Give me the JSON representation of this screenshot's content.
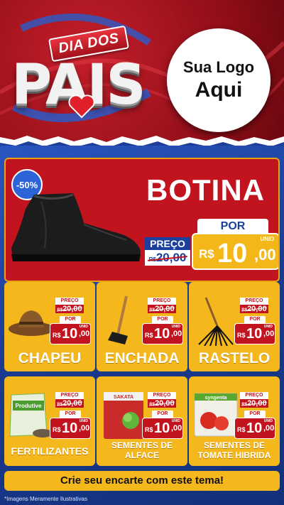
{
  "header": {
    "dia_dos": "DIA DOS",
    "pais": "PAIS",
    "logo_line1": "Sua Logo",
    "logo_line2": "Aqui"
  },
  "featured": {
    "discount": "-50%",
    "name": "BOTINA",
    "preco_label": "PREÇO",
    "old_currency": "R$",
    "old_price": "20,00",
    "por_label": "POR",
    "currency": "R$",
    "price_int": "10",
    "price_cents": ",00",
    "unit": "UNID"
  },
  "products": [
    {
      "name": "CHAPEU",
      "preco_label": "PREÇO",
      "old_currency": "R$",
      "old_price": "20,00",
      "por_label": "POR",
      "currency": "R$",
      "price_int": "10",
      "price_cents": ",00",
      "unit": "UNID"
    },
    {
      "name": "ENCHADA",
      "preco_label": "PREÇO",
      "old_currency": "R$",
      "old_price": "20,00",
      "por_label": "POR",
      "currency": "R$",
      "price_int": "10",
      "price_cents": ",00",
      "unit": "UNID"
    },
    {
      "name": "RASTELO",
      "preco_label": "PREÇO",
      "old_currency": "R$",
      "old_price": "20,00",
      "por_label": "POR",
      "currency": "R$",
      "price_int": "10",
      "price_cents": ",00",
      "unit": "UNID"
    },
    {
      "name": "FERTILIZANTES",
      "preco_label": "PREÇO",
      "old_currency": "R$",
      "old_price": "20,00",
      "por_label": "POR",
      "currency": "R$",
      "price_int": "10",
      "price_cents": ",00",
      "unit": "UNID",
      "package_label": "Produtive"
    },
    {
      "name_line1": "SEMENTES DE",
      "name_line2": "ALFACE",
      "preco_label": "PREÇO",
      "old_currency": "R$",
      "old_price": "20,00",
      "por_label": "POR",
      "currency": "R$",
      "price_int": "10",
      "price_cents": ",00",
      "unit": "UNID",
      "package_label": "SAKATA"
    },
    {
      "name_line1": "SEMENTES DE",
      "name_line2": "TOMATE HIBRIDA",
      "preco_label": "PREÇO",
      "old_currency": "R$",
      "old_price": "20,00",
      "por_label": "POR",
      "currency": "R$",
      "price_int": "10",
      "price_cents": ",00",
      "unit": "UNID",
      "package_label": "syngenta"
    }
  ],
  "footer": {
    "cta": "Crie seu encarte com este tema!",
    "disclaimer": "*Imagens Meramente Ilustrativas"
  },
  "colors": {
    "header_red": "#c41f2a",
    "card_yellow": "#f5b81c",
    "price_red": "#c1141e",
    "background_blue": "#1d3f9a"
  }
}
